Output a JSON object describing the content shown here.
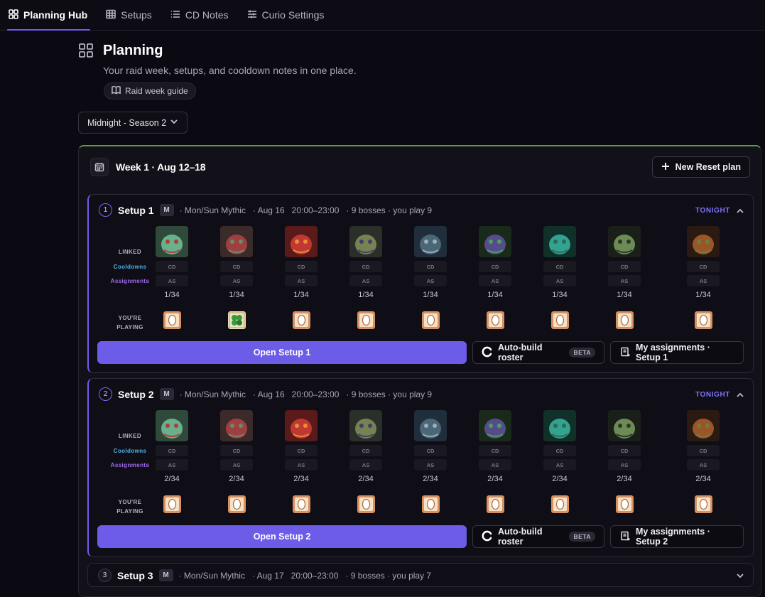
{
  "nav": {
    "tabs": [
      {
        "label": "Planning Hub",
        "icon": "grid-icon",
        "active": true
      },
      {
        "label": "Setups",
        "icon": "table-icon"
      },
      {
        "label": "CD Notes",
        "icon": "list-icon"
      },
      {
        "label": "Curio Settings",
        "icon": "sliders-icon"
      }
    ]
  },
  "header": {
    "title": "Planning",
    "subtitle": "Your raid week, setups, and cooldown notes in one place.",
    "guide_label": "Raid week guide"
  },
  "season": {
    "selected": "Midnight - Season 2"
  },
  "week": {
    "title": "Week 1 · Aug 12–18",
    "new_reset_label": "New Reset plan"
  },
  "labels": {
    "linked": "LINKED",
    "cooldowns": "Cooldowns",
    "assignments": "Assignments",
    "youre": "YOU'RE",
    "playing": "PLAYING",
    "cd_chip": "CD",
    "as_chip": "AS",
    "beta": "BETA",
    "auto_build": "Auto-build roster"
  },
  "colors": {
    "accent": "#6c5ce8",
    "week_border": "#5aa03a",
    "tonight": "#7d73ff",
    "cooldowns": "#4fb3e8",
    "assignments": "#a06cf0"
  },
  "setups": [
    {
      "number": "1",
      "name": "Setup 1",
      "difficulty": "M",
      "meta": "· Mon/Sun Mythic   · Aug 16   20:00–23:00   · 9 bosses · you play 9",
      "status": "TONIGHT",
      "expanded": true,
      "counts": [
        "1/34",
        "1/34",
        "1/34",
        "1/34",
        "1/34",
        "1/34",
        "1/34",
        "1/34",
        "1/34"
      ],
      "open_label": "Open Setup 1",
      "assign_label": "My assignments · Setup 1"
    },
    {
      "number": "2",
      "name": "Setup 2",
      "difficulty": "M",
      "meta": "· Mon/Sun Mythic   · Aug 16   20:00–23:00   · 9 bosses · you play 9",
      "status": "TONIGHT",
      "expanded": true,
      "counts": [
        "2/34",
        "2/34",
        "2/34",
        "2/34",
        "2/34",
        "2/34",
        "2/34",
        "2/34",
        "2/34"
      ],
      "open_label": "Open Setup 2",
      "assign_label": "My assignments · Setup 2"
    },
    {
      "number": "3",
      "name": "Setup 3",
      "difficulty": "M",
      "meta": "· Mon/Sun Mythic   · Aug 17   20:00–23:00   · 9 bosses · you play 7",
      "status": "",
      "expanded": false
    }
  ]
}
